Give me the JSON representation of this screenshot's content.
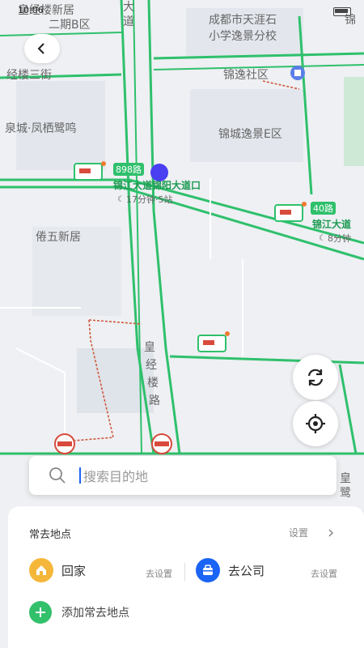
{
  "status": {
    "time": "10:06"
  },
  "map_labels": {
    "area_top_left_1": "皇经楼新居",
    "area_top_left_2": "二期B区",
    "school_1": "成都市天涯石",
    "school_2": "小学逸景分校",
    "road_da_dao_1": "大",
    "road_da_dao_2": "道",
    "jing_partial": "锦",
    "road_jing_lou_san_jie": "经楼三街",
    "community": "锦逸社区",
    "residential_fengqi": "泉城·凤栖鹭鸣",
    "residential_jingcheng": "锦城逸景E区",
    "bus_898": "898路",
    "stop_name": "锦江大道锦阳大道口",
    "stop_eta": "17分钟·5站",
    "bus_40": "40路",
    "stop_jinjiang": "锦江大道",
    "stop_eta2": "8分钟",
    "juan_wu": "倦五新居",
    "road_huangjing_1": "皇",
    "road_huangjing_2": "经",
    "road_huangjing_3": "楼",
    "road_huangjing_4": "路",
    "bottom_right": "皇",
    "bottom_right2": "鹭"
  },
  "search": {
    "placeholder": "搜索目的地"
  },
  "panel": {
    "title": "常去地点",
    "settings": "设置",
    "home_label": "回家",
    "home_sub": "去设置",
    "work_label": "去公司",
    "work_sub": "去设置",
    "add_label": "添加常去地点"
  },
  "colors": {
    "road_green": "#2fc06c",
    "brand_blue": "#1b64f5",
    "home_yellow": "#f5b73a",
    "add_green": "#33c06b"
  }
}
